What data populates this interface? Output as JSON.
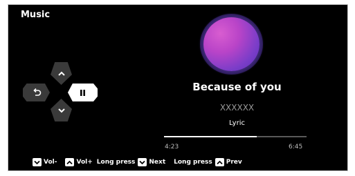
{
  "app": {
    "title": "Music"
  },
  "track": {
    "title": "Because of you",
    "artist": "XXXXXX",
    "lyric_label": "Lyric",
    "elapsed": "4:23",
    "total": "6:45",
    "progress_fraction": 0.65
  },
  "hints": {
    "vol_down": "Vol-",
    "vol_up": "Vol+",
    "long_press_next_prefix": "Long press",
    "next": "Next",
    "long_press_prev_prefix": "Long press",
    "prev": "Prev"
  },
  "icons": {
    "up": "chevron-up-icon",
    "down": "chevron-down-icon",
    "back": "back-arrow-icon",
    "play_pause": "pause-icon"
  },
  "colors": {
    "background": "#000000",
    "text": "#ffffff",
    "artist": "#9a9a9a",
    "album_primary": "#b944c8",
    "album_secondary": "#5a30b8"
  }
}
